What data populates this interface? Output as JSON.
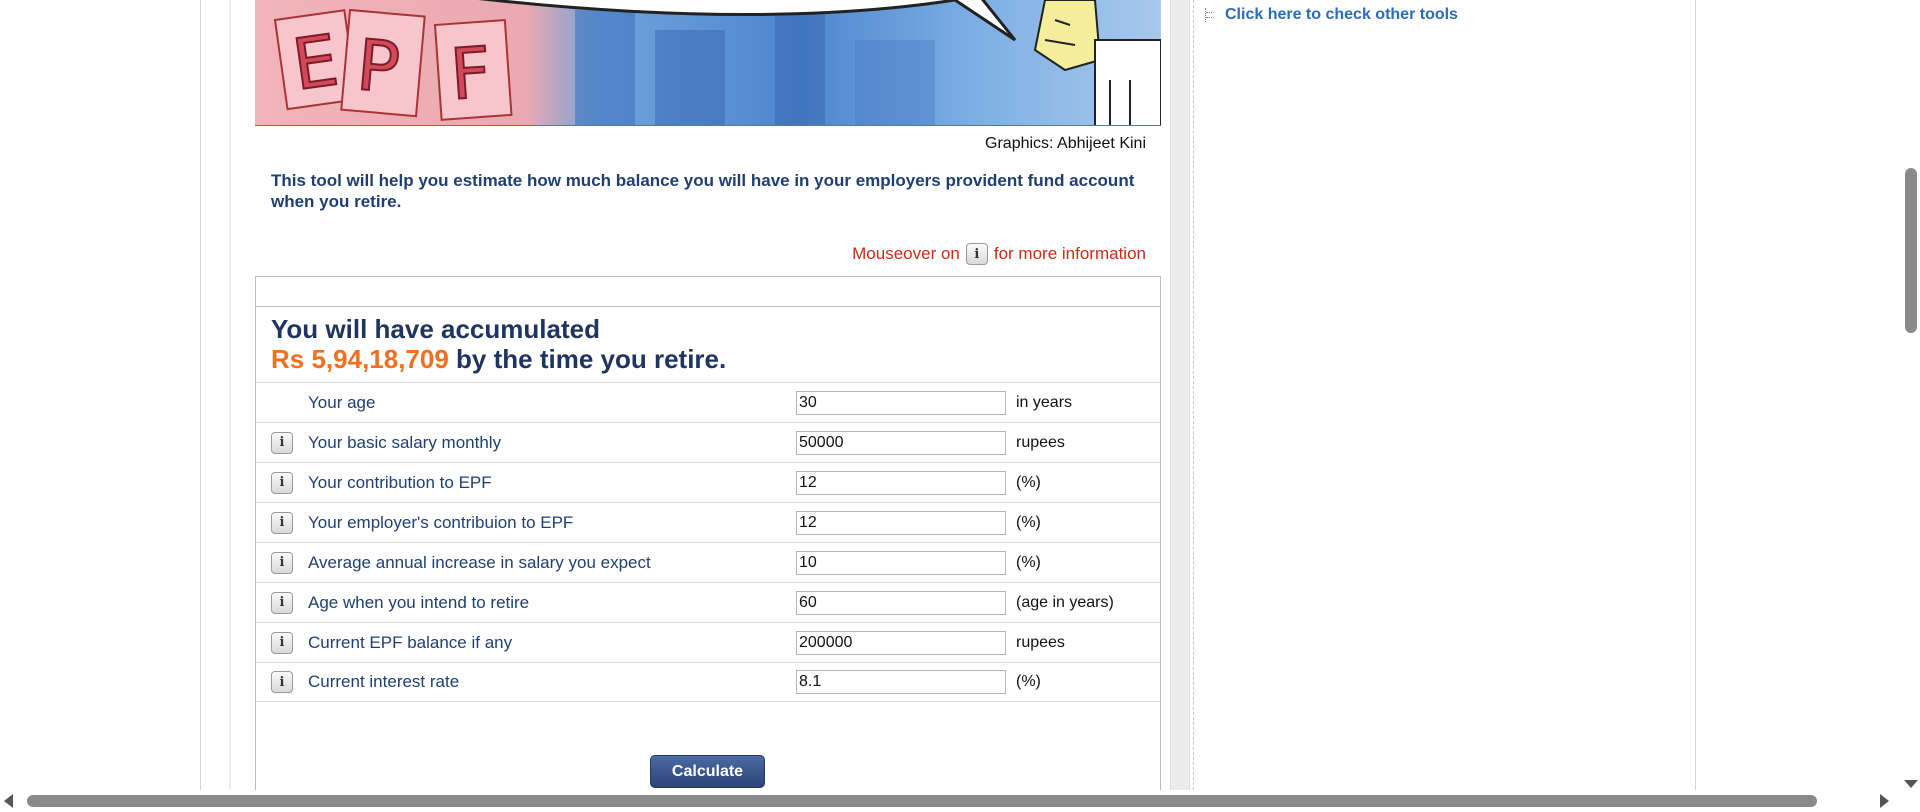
{
  "sidebar": {
    "tools_link": "Click here to check other tools"
  },
  "banner": {
    "image_text": "EPF",
    "credit": "Graphics: Abhijeet Kini"
  },
  "intro_text": "This tool will help you estimate how much balance you will have in your employers provident fund account when you retire.",
  "mouseover": {
    "before": "Mouseover on",
    "icon_glyph": "i",
    "after": "for more information"
  },
  "result": {
    "line1": "You will have accumulated",
    "amount": "Rs 5,94,18,709",
    "line2_rest": " by the time you retire."
  },
  "fields": [
    {
      "label": "Your age",
      "value": "30",
      "unit": "in years",
      "has_info": false
    },
    {
      "label": "Your basic salary monthly",
      "value": "50000",
      "unit": "rupees",
      "has_info": true
    },
    {
      "label": "Your contribution to EPF",
      "value": "12",
      "unit": "(%)",
      "has_info": true
    },
    {
      "label": "Your employer's contribuion to EPF",
      "value": "12",
      "unit": "(%)",
      "has_info": true
    },
    {
      "label": "Average annual increase in salary you expect",
      "value": "10",
      "unit": "(%)",
      "has_info": true
    },
    {
      "label": "Age when you intend to retire",
      "value": "60",
      "unit": "(age in years)",
      "has_info": true
    },
    {
      "label": "Current EPF balance if any",
      "value": "200000",
      "unit": "rupees",
      "has_info": true
    },
    {
      "label": "Current interest rate",
      "value": "8.1",
      "unit": "(%)",
      "has_info": true
    }
  ],
  "calculate_label": "Calculate",
  "colors": {
    "label_blue": "#1f3f73",
    "amount_orange": "#f07020",
    "mouseover_red": "#cc2b14",
    "link_blue": "#2b6cb8"
  }
}
